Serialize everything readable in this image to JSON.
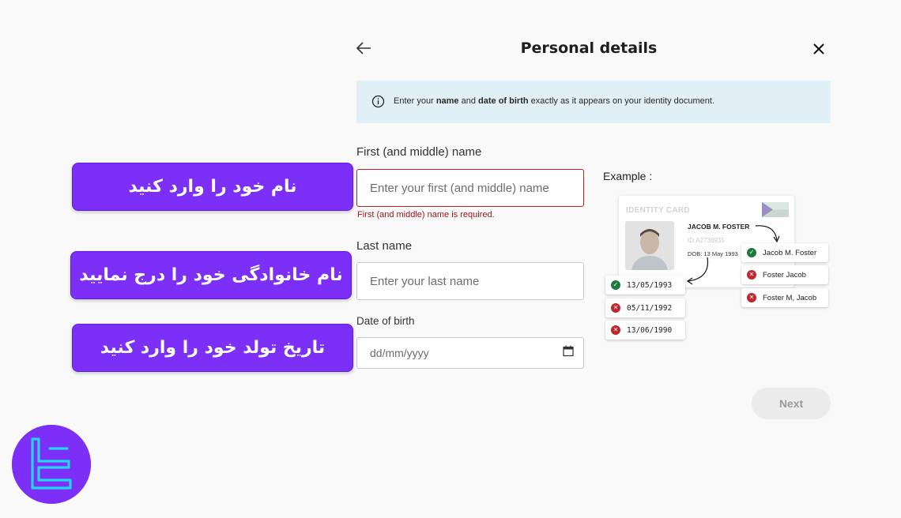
{
  "header": {
    "title": "Personal details",
    "back_icon": "arrow-left-icon",
    "close_icon": "close-icon"
  },
  "info_banner": {
    "icon": "info-icon",
    "text_before": "Enter your ",
    "bold_name": "name",
    "text_and": " and ",
    "bold_dob": "date of birth",
    "text_after": " exactly as it appears on your identity document."
  },
  "form": {
    "first_name": {
      "label": "First (and middle) name",
      "placeholder": "Enter your first (and middle) name",
      "value": "",
      "error": "First (and middle) name is required."
    },
    "last_name": {
      "label": "Last name",
      "placeholder": "Enter your last name",
      "value": ""
    },
    "dob": {
      "label": "Date of birth",
      "placeholder": "dd/mm/yyyy",
      "icon": "calendar-icon"
    }
  },
  "annotations": {
    "first_name": "نام خود را وارد کنید",
    "last_name": "نام خانوادگی خود را درج نمایید",
    "dob": "تاریخ تولد خود را وارد کنید"
  },
  "example": {
    "label": "Example :",
    "card": {
      "title": "IDENTITY CARD",
      "name": "JACOB M. FOSTER",
      "id_number": "ID:A2738935",
      "dob": "DOB: 13 May 1993"
    },
    "name_options": [
      {
        "text": "Jacob M. Foster",
        "status": "valid"
      },
      {
        "text": "Foster Jacob",
        "status": "invalid"
      },
      {
        "text": "Foster M, Jacob",
        "status": "invalid"
      }
    ],
    "dob_options": [
      {
        "text": "13/05/1993",
        "status": "valid"
      },
      {
        "text": "05/11/1992",
        "status": "invalid"
      },
      {
        "text": "13/06/1990",
        "status": "invalid"
      }
    ]
  },
  "footer": {
    "next_label": "Next",
    "next_enabled": false
  },
  "colors": {
    "accent_purple": "#7b2ff7",
    "error_red": "#a4161a",
    "info_bg": "#e1f0f7",
    "valid_green": "#1f7a3a",
    "invalid_red": "#c0262d"
  },
  "logo": {
    "icon": "brand-logo-icon"
  }
}
